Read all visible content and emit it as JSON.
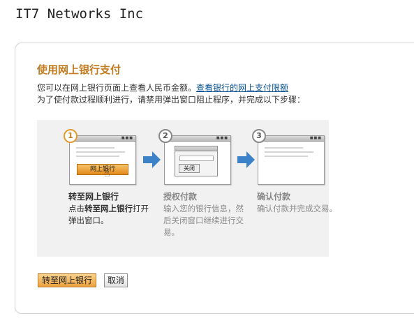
{
  "merchant": "IT7 Networks Inc",
  "panel": {
    "title": "使用网上银行支付",
    "intro_line1": "您可以在网上银行页面上查看人民币金额。",
    "intro_link": "查看银行的网上支付限额",
    "intro_line2": "为了使付款过程顺利进行，请禁用弹出窗口阻止程序，并完成以下步骤："
  },
  "steps": [
    {
      "number": "1",
      "illustration_button": "网上银行",
      "title": "转至网上银行",
      "desc_prefix": "点击",
      "desc_bold": "转至网上银行",
      "desc_suffix": "打开弹出窗口。",
      "state": "active"
    },
    {
      "number": "2",
      "illustration_button": "关闭",
      "title": "授权付款",
      "desc": "输入您的银行信息，然后关闭窗口继续进行交易。",
      "state": "inactive"
    },
    {
      "number": "3",
      "title": "确认付款",
      "desc": "确认付款并完成交易。",
      "state": "inactive"
    }
  ],
  "actions": {
    "primary": "转至网上银行",
    "cancel": "取消"
  },
  "icons": {
    "window_controls": "■■■",
    "cursor": "☝"
  },
  "colors": {
    "title": "#c27b1e",
    "link": "#0b5394",
    "primary_button": "#eda23d",
    "step_arrow": "#3b82c9"
  }
}
